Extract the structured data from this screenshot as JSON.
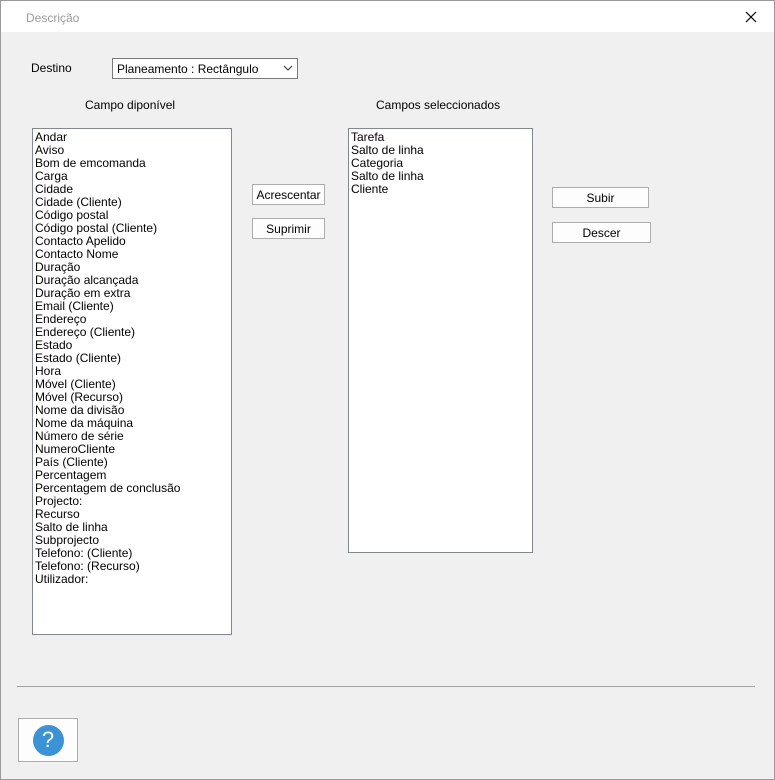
{
  "window": {
    "title": "Descrição"
  },
  "destino": {
    "label": "Destino",
    "selected": "Planeamento : Rectângulo"
  },
  "available": {
    "heading": "Campo diponível",
    "items": [
      "Andar",
      "Aviso",
      "Bom de emcomanda",
      "Carga",
      "Cidade",
      "Cidade (Cliente)",
      "Código postal",
      "Código postal (Cliente)",
      "Contacto Apelido",
      "Contacto Nome",
      "Duração",
      "Duração alcançada",
      "Duração em extra",
      "Email (Cliente)",
      "Endereço",
      "Endereço (Cliente)",
      "Estado",
      "Estado (Cliente)",
      "Hora",
      "Móvel (Cliente)",
      "Móvel (Recurso)",
      "Nome da divisão",
      "Nome da máquina",
      "Número de série",
      "NumeroCliente",
      "País (Cliente)",
      "Percentagem",
      "Percentagem de conclusão",
      "Projecto:",
      "Recurso",
      "Salto de linha",
      "Subprojecto",
      "Telefono: (Cliente)",
      "Telefono: (Recurso)",
      "Utilizador:"
    ]
  },
  "selected": {
    "heading": "Campos seleccionados",
    "items": [
      "Tarefa",
      "Salto de linha",
      "Categoria",
      "Salto de linha",
      "Cliente"
    ]
  },
  "buttons": {
    "add": "Acrescentar",
    "remove": "Suprimir",
    "up": "Subir",
    "down": "Descer",
    "help": "?"
  },
  "colors": {
    "help_accent": "#3a93d7",
    "dialog_bg": "#f0f0f0"
  }
}
